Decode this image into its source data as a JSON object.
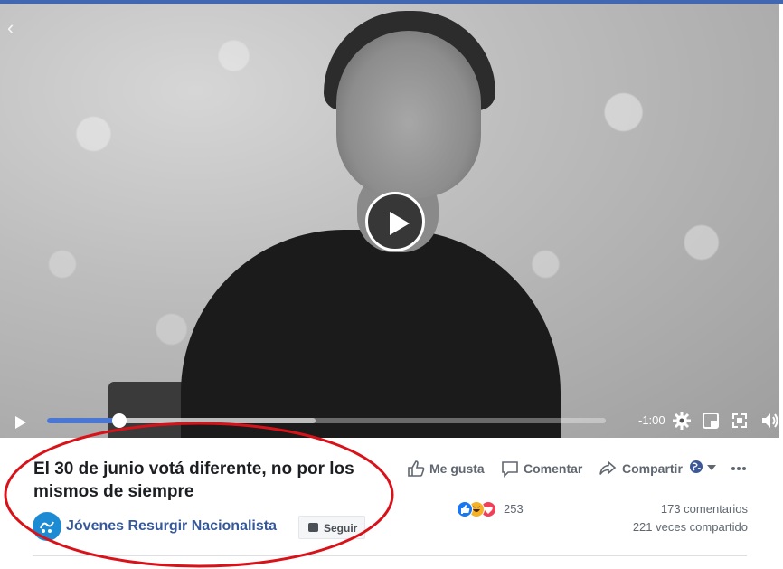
{
  "video": {
    "time_remaining": "-1:00",
    "progress_fraction": 0.13,
    "buffered_fraction": 0.48
  },
  "post": {
    "title": "El 30 de junio votá diferente, no por los mismos de siempre",
    "page_name": "Jóvenes Resurgir Nacionalista",
    "follow_label": "Seguir"
  },
  "actions": {
    "like_label": "Me gusta",
    "comment_label": "Comentar",
    "share_label": "Compartir"
  },
  "stats": {
    "reactions_count": "253",
    "comments": "173 comentarios",
    "shares": "221 veces compartido"
  },
  "colors": {
    "facebook_blue": "#4267b2",
    "link_blue": "#365899",
    "progress_blue": "#4a76d4",
    "annotation_red": "#d9121a"
  },
  "icons": [
    "back-arrow-icon",
    "play-icon",
    "gear-icon",
    "picture-in-picture-icon",
    "fullscreen-icon",
    "volume-icon",
    "thumbs-up-icon",
    "comment-icon",
    "share-icon",
    "globe-icon",
    "more-icon",
    "like-reaction-icon",
    "haha-reaction-icon",
    "love-reaction-icon"
  ]
}
